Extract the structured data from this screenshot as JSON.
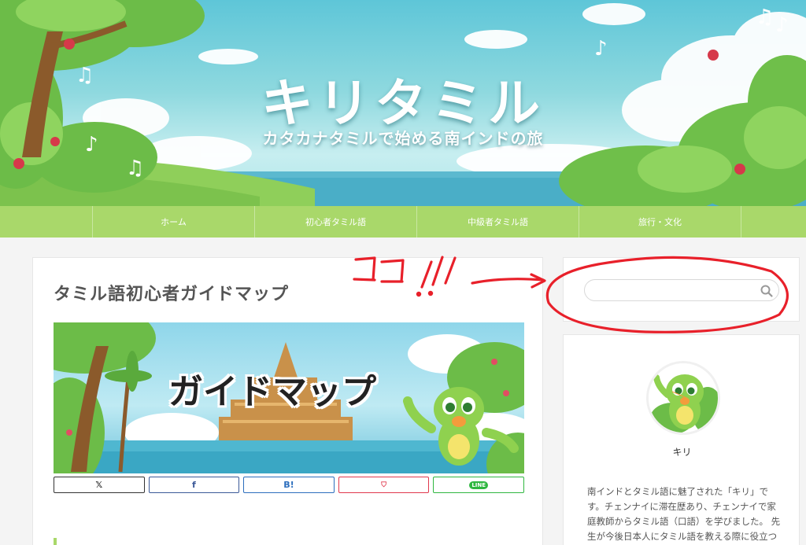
{
  "header": {
    "site_title": "キリタミル",
    "tagline": "カタカナタミルで始める南インドの旅"
  },
  "nav": {
    "items": [
      {
        "label": ""
      },
      {
        "label": "ホーム"
      },
      {
        "label": "初心者タミル語"
      },
      {
        "label": "中級者タミル語"
      },
      {
        "label": "旅行・文化"
      },
      {
        "label": ""
      }
    ]
  },
  "article": {
    "title": "タミル語初心者ガイドマップ",
    "eyecatch_text": "ガイドマップ",
    "share_buttons": [
      {
        "name": "x",
        "icon": "x-logo-icon",
        "label": "𝕏"
      },
      {
        "name": "facebook",
        "icon": "facebook-icon",
        "label": "f"
      },
      {
        "name": "hatena",
        "icon": "hatena-bookmark-icon",
        "label": "B!"
      },
      {
        "name": "pocket",
        "icon": "pocket-icon",
        "label": "⛉"
      },
      {
        "name": "line",
        "icon": "line-icon",
        "label": "LINE"
      }
    ]
  },
  "sidebar": {
    "search": {
      "value": "",
      "placeholder": "",
      "icon": "search-icon"
    },
    "profile": {
      "name": "キリ",
      "bio": "南インドとタミル語に魅了された「キリ」です。チェンナイに滞在歴あり、チェンナイで家庭教師からタミル語（口語）を学びました。 先生が今後日本人にタミル語を教える際に役立つよう、びが喋れるように"
    }
  },
  "annotation": {
    "text": "ココ !!",
    "color": "#e8202a"
  },
  "colors": {
    "nav_bg": "#a9d86a",
    "accent_green": "#a9d86a",
    "annotation_red": "#e8202a"
  }
}
